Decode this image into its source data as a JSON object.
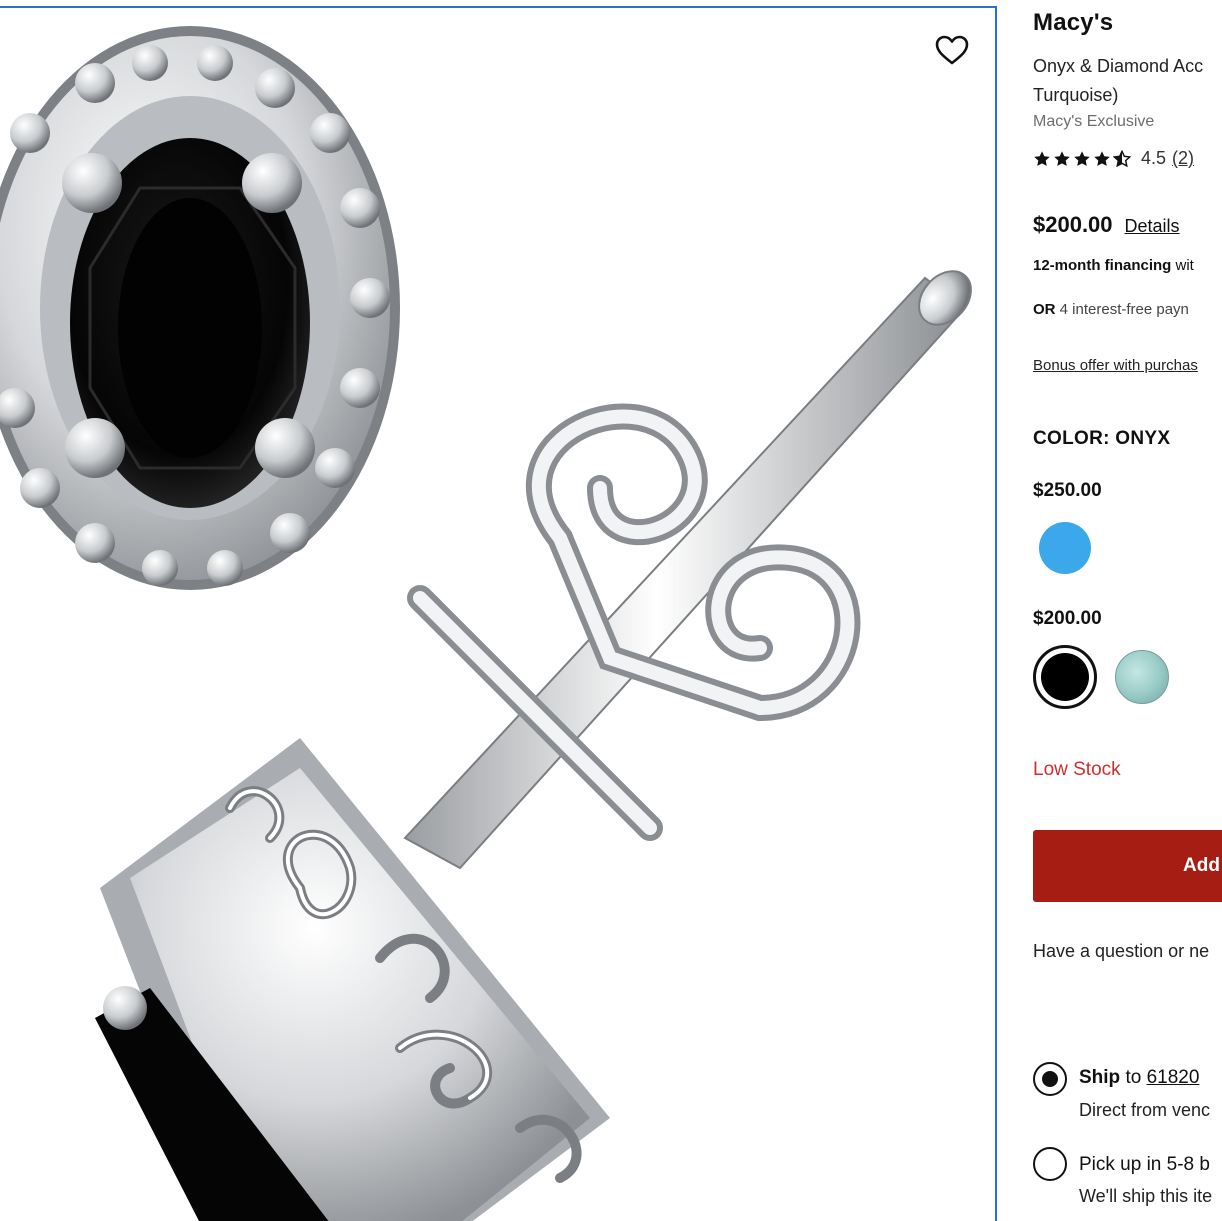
{
  "product_image": {
    "alt": "Onyx oval stud earrings with diamond accent halo in sterling silver",
    "wishlist_icon": "heart-outline-icon"
  },
  "details": {
    "brand": "Macy's",
    "name_line1": "Onyx & Diamond Acc",
    "name_line2": "Turquoise)",
    "exclusive": "Macy's Exclusive",
    "rating": {
      "value": "4.5",
      "count": "(2)",
      "stars": 4.5,
      "star_icon": "star-icon"
    },
    "price": "$200.00",
    "details_link": "Details",
    "financing_bold": "12-month financing",
    "financing_rest": " wit",
    "pay_or": "OR",
    "pay_rest": " 4 interest-free payn",
    "bonus": "Bonus offer with purchas",
    "color_label": "COLOR: ONYX",
    "tiers": [
      {
        "price": "$250.00",
        "swatches": [
          {
            "name": "Turquoise",
            "color": "#3aa8ea",
            "selected": false
          }
        ]
      },
      {
        "price": "$200.00",
        "swatches": [
          {
            "name": "Onyx",
            "color": "#000000",
            "selected": true
          },
          {
            "name": "Larimar",
            "color": "#9fd0cc",
            "selected": false
          }
        ]
      }
    ],
    "stock": "Low Stock",
    "add_button": "Add",
    "question": "Have a question or ne",
    "fulfillment": [
      {
        "checked": true,
        "title_bold": "Ship",
        "title_mid": " to ",
        "zip": "61820",
        "sub": "Direct from venc"
      },
      {
        "checked": false,
        "title_bold": "",
        "title_mid": "Pick up in 5-8 b",
        "zip": "",
        "sub": "We'll ship this ite"
      }
    ]
  }
}
